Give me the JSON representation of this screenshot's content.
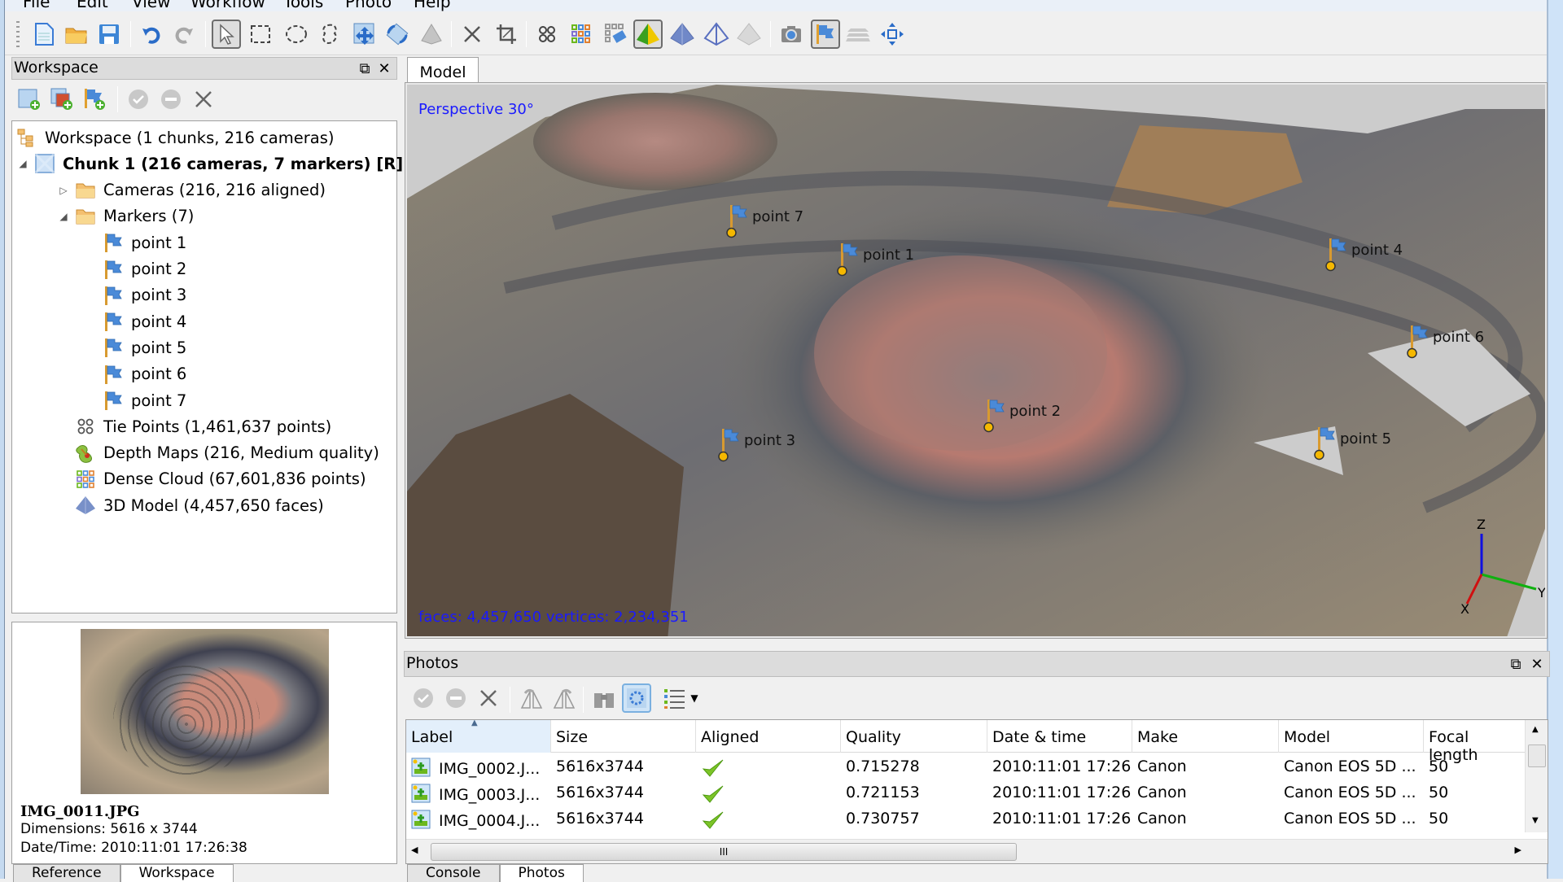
{
  "menu": [
    "File",
    "Edit",
    "View",
    "Workflow",
    "Tools",
    "Photo",
    "Help"
  ],
  "toolbar": {
    "buttons": [
      {
        "name": "new-icon",
        "active": false
      },
      {
        "name": "open-icon",
        "active": false
      },
      {
        "name": "save-icon",
        "active": false
      },
      {
        "name": "undo-icon",
        "active": false
      },
      {
        "name": "redo-icon",
        "active": false
      },
      {
        "name": "navigation-cursor-icon",
        "active": true
      },
      {
        "name": "rectangle-selection-icon",
        "active": false
      },
      {
        "name": "circle-selection-icon",
        "active": false
      },
      {
        "name": "free-form-selection-icon",
        "active": false
      },
      {
        "name": "move-region-icon",
        "active": false
      },
      {
        "name": "rotate-region-icon",
        "active": false
      },
      {
        "name": "resize-region-icon",
        "active": false
      },
      {
        "name": "delete-selection-icon",
        "active": false
      },
      {
        "name": "crop-selection-icon",
        "active": false
      },
      {
        "name": "tie-points-icon",
        "active": false
      },
      {
        "name": "dense-cloud-icon",
        "active": false
      },
      {
        "name": "dense-cloud-classes-icon",
        "active": false
      },
      {
        "name": "model-textured-icon",
        "active": true
      },
      {
        "name": "model-solid-icon",
        "active": false
      },
      {
        "name": "model-wireframe-icon",
        "active": false
      },
      {
        "name": "model-shaded-icon",
        "active": false
      },
      {
        "name": "show-cameras-icon",
        "active": false
      },
      {
        "name": "show-markers-icon",
        "active": true
      },
      {
        "name": "show-layers-icon",
        "active": false
      },
      {
        "name": "reset-view-icon",
        "active": false
      }
    ]
  },
  "workspace": {
    "title": "Workspace",
    "tree": [
      {
        "label": "Workspace (1 chunks, 216 cameras)",
        "icon": "workspace-icon",
        "level": 0,
        "bold": false
      },
      {
        "label": "Chunk 1 (216 cameras, 7 markers) [R]",
        "icon": "chunk-icon",
        "level": 1,
        "bold": true,
        "expander": "expanded"
      },
      {
        "label": "Cameras (216, 216 aligned)",
        "icon": "folder-icon",
        "level": 2,
        "bold": false,
        "expander": "collapsed"
      },
      {
        "label": "Markers (7)",
        "icon": "folder-icon",
        "level": 2,
        "bold": false,
        "expander": "expanded"
      },
      {
        "label": "point 1",
        "icon": "marker-flag-icon",
        "level": 3
      },
      {
        "label": "point 2",
        "icon": "marker-flag-icon",
        "level": 3
      },
      {
        "label": "point 3",
        "icon": "marker-flag-icon",
        "level": 3
      },
      {
        "label": "point 4",
        "icon": "marker-flag-icon",
        "level": 3
      },
      {
        "label": "point 5",
        "icon": "marker-flag-icon",
        "level": 3
      },
      {
        "label": "point 6",
        "icon": "marker-flag-icon",
        "level": 3
      },
      {
        "label": "point 7",
        "icon": "marker-flag-icon",
        "level": 3
      },
      {
        "label": "Tie Points (1,461,637 points)",
        "icon": "tie-points-icon",
        "level": 2
      },
      {
        "label": "Depth Maps (216, Medium quality)",
        "icon": "depth-maps-icon",
        "level": 2
      },
      {
        "label": "Dense Cloud (67,601,836 points)",
        "icon": "dense-cloud-icon",
        "level": 2
      },
      {
        "label": "3D Model (4,457,650 faces)",
        "icon": "model-icon",
        "level": 2
      }
    ]
  },
  "preview": {
    "filename": "IMG_0011.JPG",
    "dimensions": "Dimensions: 5616 x 3744",
    "datetime": "Date/Time: 2010:11:01 17:26:38"
  },
  "left_tabs": [
    {
      "label": "Reference",
      "active": false
    },
    {
      "label": "Workspace",
      "active": true
    }
  ],
  "model_view": {
    "tab": "Model",
    "projection": "Perspective 30°",
    "stats": "faces: 4,457,650 vertices: 2,234,351",
    "axes": {
      "x": "X",
      "y": "Y",
      "z": "Z",
      "x_color": "#d01010",
      "y_color": "#10b010",
      "z_color": "#1010e0"
    },
    "markers": [
      {
        "label": "point 7"
      },
      {
        "label": "point 1"
      },
      {
        "label": "point 4"
      },
      {
        "label": "point 6"
      },
      {
        "label": "point 2"
      },
      {
        "label": "point 3"
      },
      {
        "label": "point 5"
      }
    ]
  },
  "photos": {
    "title": "Photos",
    "columns": [
      "Label",
      "Size",
      "Aligned",
      "Quality",
      "Date & time",
      "Make",
      "Model",
      "Focal length"
    ],
    "sort_column": "Label",
    "rows": [
      {
        "label": "IMG_0002.J...",
        "size": "5616x3744",
        "aligned": true,
        "quality": "0.715278",
        "datetime": "2010:11:01 17:26...",
        "make": "Canon",
        "model": "Canon EOS 5D ...",
        "focal": "50"
      },
      {
        "label": "IMG_0003.J...",
        "size": "5616x3744",
        "aligned": true,
        "quality": "0.721153",
        "datetime": "2010:11:01 17:26...",
        "make": "Canon",
        "model": "Canon EOS 5D ...",
        "focal": "50"
      },
      {
        "label": "IMG_0004.J...",
        "size": "5616x3744",
        "aligned": true,
        "quality": "0.730757",
        "datetime": "2010:11:01 17:26...",
        "make": "Canon",
        "model": "Canon EOS 5D ...",
        "focal": "50"
      }
    ],
    "hscroll_label": "III"
  },
  "bottom_tabs": [
    {
      "label": "Console",
      "active": false
    },
    {
      "label": "Photos",
      "active": true
    }
  ],
  "colors": {
    "viewport_text": "#1a1aff",
    "marker_dot": "#f5b800",
    "flag": "#4a8ad8",
    "check": "#6cb81e"
  }
}
